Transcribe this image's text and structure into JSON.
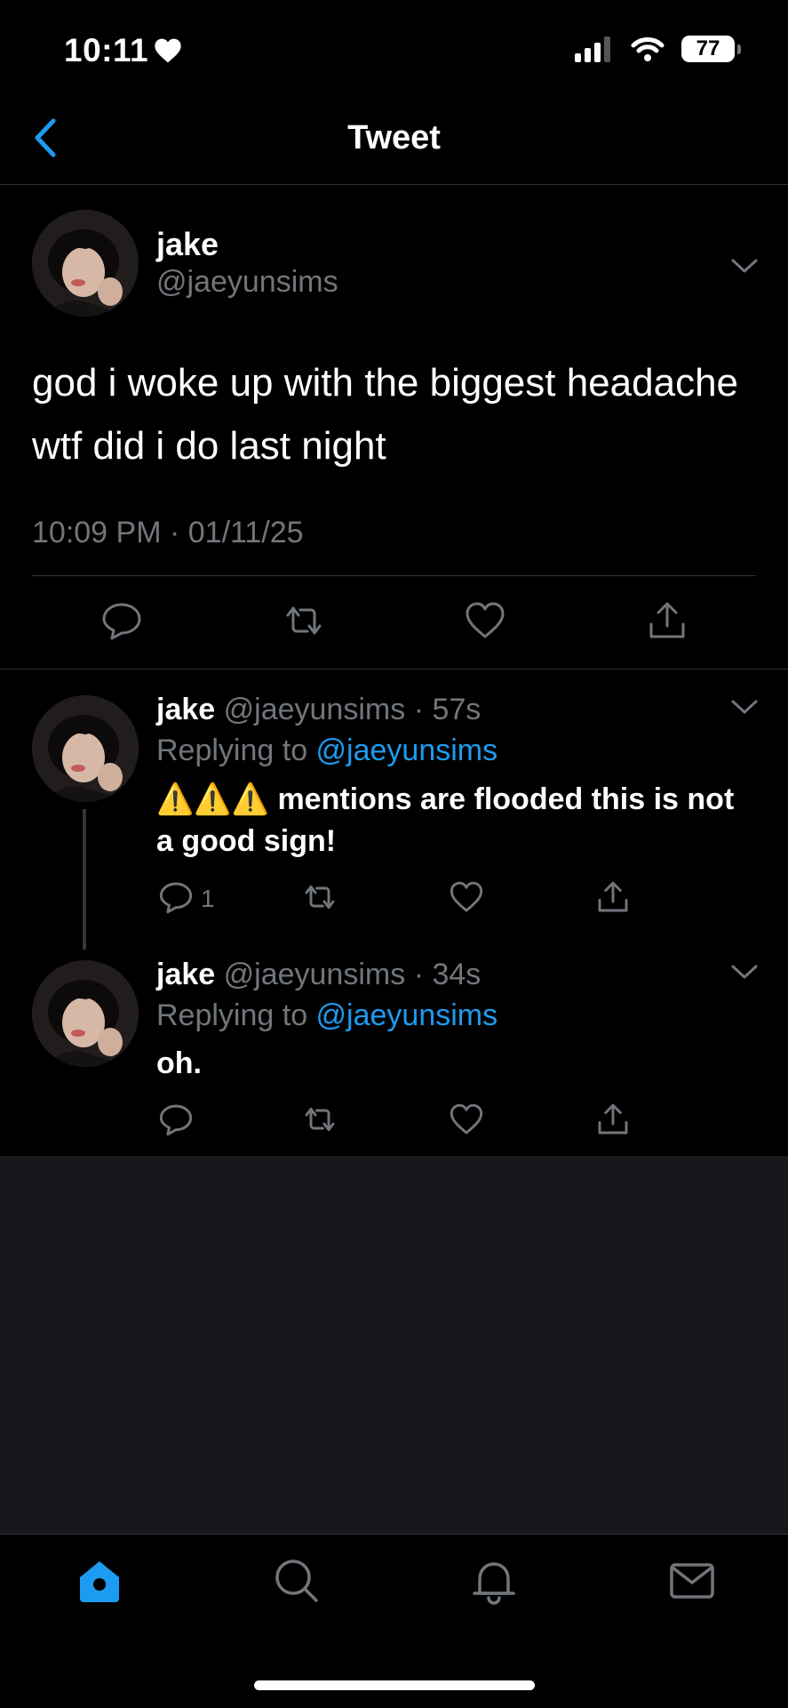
{
  "status_bar": {
    "time": "10:11",
    "battery": "77"
  },
  "header": {
    "title": "Tweet"
  },
  "main_tweet": {
    "name": "jake",
    "handle": "@jaeyunsims",
    "text": "god i woke up with the biggest headache wtf did i do last night",
    "timestamp": "10:09 PM · 01/11/25"
  },
  "replies": [
    {
      "name": "jake",
      "handle": "@jaeyunsims",
      "time": "· 57s",
      "replying_prefix": "Replying to ",
      "replying_to": "@jaeyunsims",
      "text": "⚠️⚠️⚠️ mentions are flooded this is not a good sign!",
      "reply_count": "1"
    },
    {
      "name": "jake",
      "handle": "@jaeyunsims",
      "time": "· 34s",
      "replying_prefix": "Replying to ",
      "replying_to": "@jaeyunsims",
      "text": "oh.",
      "reply_count": ""
    }
  ],
  "colors": {
    "accent": "#1d9bf0",
    "muted": "#71767b",
    "background": "#000000"
  },
  "icons": {
    "back": "chevron-left-icon",
    "reply": "comment-icon",
    "retweet": "retweet-icon",
    "like": "heart-icon",
    "share": "share-icon",
    "tabs": [
      "home-icon",
      "search-icon",
      "bell-icon",
      "mail-icon"
    ]
  }
}
